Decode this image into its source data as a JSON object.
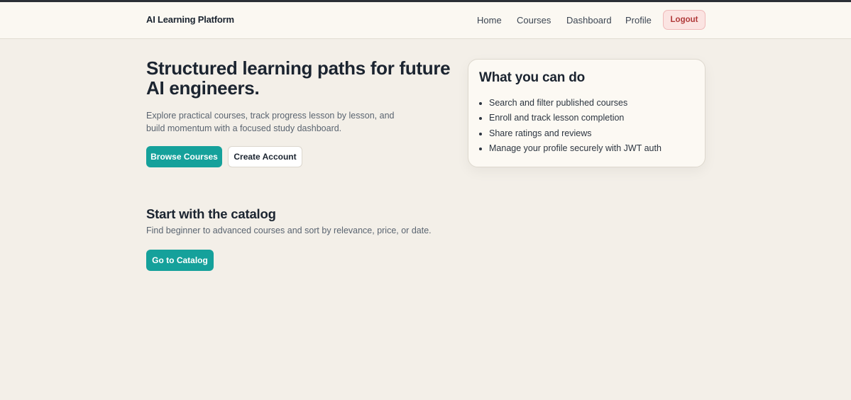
{
  "header": {
    "brand": "AI Learning Platform",
    "nav": [
      "Home",
      "Courses",
      "Dashboard",
      "Profile"
    ],
    "logout_label": "Logout"
  },
  "hero": {
    "title": "Structured learning paths for future AI engineers.",
    "lead": "Explore practical courses, track progress lesson by lesson, and build momentum with a focused study dashboard.",
    "browse_label": "Browse Courses",
    "create_label": "Create Account"
  },
  "features": {
    "title": "What you can do",
    "items": [
      "Search and filter published courses",
      "Enroll and track lesson completion",
      "Share ratings and reviews",
      "Manage your profile securely with JWT auth"
    ]
  },
  "catalog": {
    "title": "Start with the catalog",
    "subtitle": "Find beginner to advanced courses and sort by relevance, price, or date.",
    "button_label": "Go to Catalog"
  },
  "colors": {
    "accent": "#15a19b",
    "background": "#f3efe8",
    "logout_bg": "#fbe4e2",
    "logout_text": "#b03a3a"
  }
}
